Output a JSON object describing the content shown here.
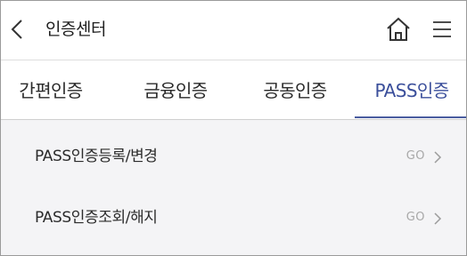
{
  "header": {
    "title": "인증센터",
    "back_icon": "chevron-left-icon",
    "home_icon": "home-icon",
    "menu_icon": "hamburger-menu-icon"
  },
  "tabs": [
    {
      "label": "간편인증",
      "active": false
    },
    {
      "label": "금융인증",
      "active": false
    },
    {
      "label": "공동인증",
      "active": false
    },
    {
      "label": "PASS인증",
      "active": true
    }
  ],
  "list": [
    {
      "label": "PASS인증등록/변경",
      "action": "GO"
    },
    {
      "label": "PASS인증조회/해지",
      "action": "GO"
    }
  ],
  "colors": {
    "accent": "#3b4f9b",
    "list_background": "#f4f4f6",
    "go_text": "#a8a8a8"
  }
}
